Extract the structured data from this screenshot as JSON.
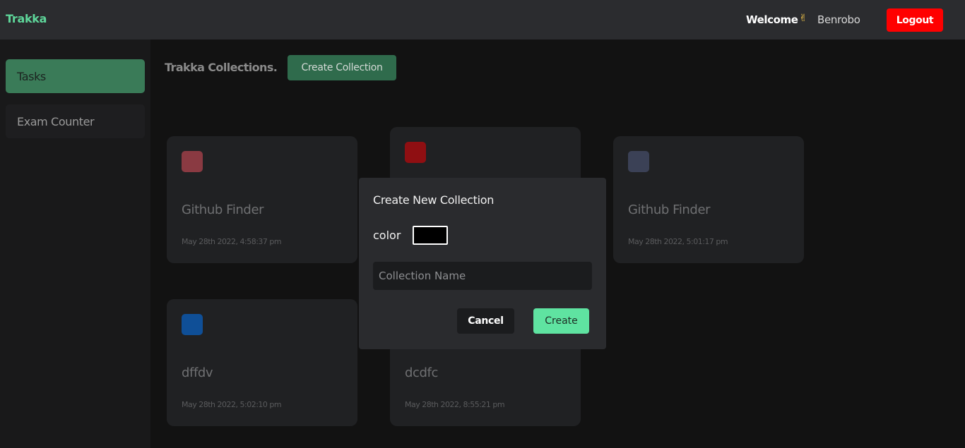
{
  "app": {
    "brand": "Trakka"
  },
  "header": {
    "welcome_label": "Welcome",
    "wave_emoji": "✌",
    "username": "Benrobo",
    "logout_label": "Logout"
  },
  "sidebar": {
    "items": [
      {
        "label": "Tasks",
        "active": true
      },
      {
        "label": "Exam Counter",
        "active": false
      }
    ]
  },
  "main": {
    "title": "Trakka Collections.",
    "create_button_label": "Create Collection",
    "collections": [
      {
        "name": "Github Finder",
        "date": "May 28th 2022, 4:58:37 pm",
        "color": "#8a3a42"
      },
      {
        "name": "",
        "date": "",
        "color": "#8f0f12"
      },
      {
        "name": "Github Finder",
        "date": "May 28th 2022, 5:01:17 pm",
        "color": "#3b4156"
      },
      {
        "name": "dffdv",
        "date": "May 28th 2022, 5:02:10 pm",
        "color": "#0f4f97"
      },
      {
        "name": "dcdfc",
        "date": "May 28th 2022, 8:55:21 pm",
        "color": ""
      }
    ]
  },
  "modal": {
    "title": "Create New Collection",
    "color_label": "color",
    "color_value": "#000000",
    "name_placeholder": "Collection Name",
    "name_value": "",
    "cancel_label": "Cancel",
    "create_label": "Create"
  },
  "colors": {
    "accent": "#5fe3a1",
    "brand": "#5ed69a",
    "danger": "#ff0000"
  }
}
